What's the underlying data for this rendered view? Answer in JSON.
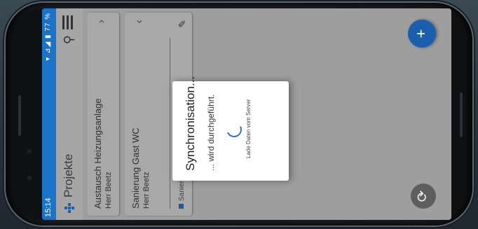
{
  "status": {
    "time": "15:14",
    "battery": "77 %",
    "icons": "▾ ⊿◢ ▮"
  },
  "app": {
    "title": "Projekte",
    "logo_icon": "grid-logo-icon",
    "search_icon": "search-filter-icon",
    "menu_icon": "menu-icon"
  },
  "projects": [
    {
      "name": "Austausch Heizungsanlage",
      "owner": "Herr Beetz",
      "chevron": "›"
    },
    {
      "name": "Sanierung Gast WC",
      "owner": "Herr Beetz",
      "chevron": "‹",
      "subitem": "Sanieru",
      "edit_icon": "edit-icon"
    }
  ],
  "fab": {
    "label": "+"
  },
  "sync_button": {
    "glyph": "⟳"
  },
  "dialog": {
    "title": "Synchronisation...",
    "message": "... wird durchgeführt.",
    "subtext": "Lade Daten vom Server"
  },
  "colors": {
    "status_bar": "#1a73c9",
    "accent": "#1a5eae",
    "overlay": "#9e9e9e"
  }
}
